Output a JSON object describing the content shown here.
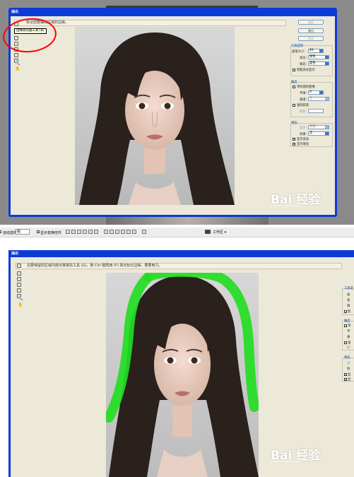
{
  "top_dialog": {
    "title": "抽出",
    "hint": "标记您要抽出区域的边缘。",
    "tooltip": "边缘高光器工具 (B)",
    "buttons": {
      "ok": "确定",
      "reset": "复位",
      "preview": "预览"
    },
    "tool_options": {
      "title": "工具选项",
      "brush_size_label": "画笔大小:",
      "brush_size_value": "40",
      "highlight_label": "高光:",
      "highlight_value": "绿色",
      "fill_label": "填充:",
      "fill_value": "蓝色",
      "smart_highlight_label": "智能高光显示"
    },
    "extraction": {
      "title": "抽出",
      "textured_label": "带纹理的图像",
      "smooth_label": "平滑:",
      "smooth_value": "0",
      "channel_label": "通道:",
      "channel_value": "无",
      "force_fg_label": "强制前景",
      "color_label": "颜色:"
    },
    "preview": {
      "title": "预览",
      "show_label": "显示:",
      "show_value": "原稿",
      "effect_label": "效果:",
      "effect_value": "无",
      "show_highlight_label": "显示高光",
      "show_fill_label": "显示填充"
    }
  },
  "toolbar": {
    "auto_select_label": "自动选择:",
    "layer_value": "组",
    "show_transform_label": "显示变换控件",
    "workspace_label": "工作区 ▾"
  },
  "bottom_dialog": {
    "title": "抽出",
    "hint": "在要保留的区域内部点按填充工具 (G)，按 Ctrl 键再用 (F) 高光标记边缘，要要用力。",
    "right_labels": [
      "工具选",
      "画",
      "高",
      "填",
      "智",
      "抽出",
      "带",
      "平",
      "通",
      "强",
      "颜",
      "预览",
      "显",
      "效",
      "显",
      "显"
    ]
  },
  "watermark": {
    "main": "Bai 经验",
    "sub": "jingyan.baidu.com"
  },
  "colors": {
    "title_bar": "#0b3bd6",
    "dialog_body": "#ece9d8",
    "annotation_circle": "#ff0000",
    "green_highlight": "#22dd22"
  }
}
